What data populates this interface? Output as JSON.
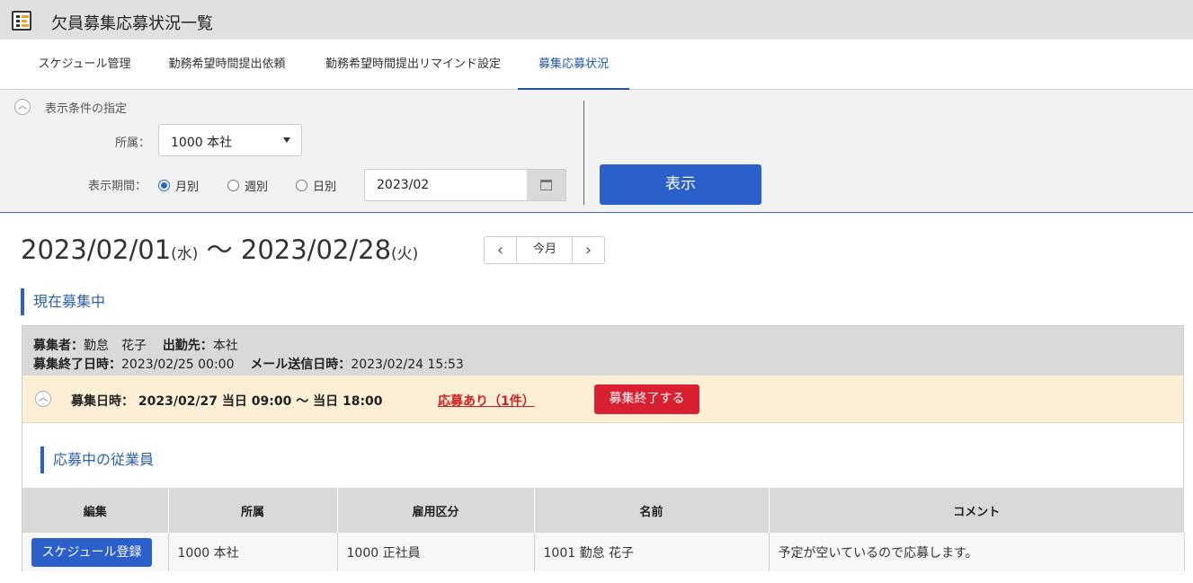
{
  "window": {
    "title": "欠員募集応募状況一覧",
    "icon": "list-app-icon"
  },
  "tabs": [
    {
      "label": "スケジュール管理",
      "active": false
    },
    {
      "label": "勤務希望時間提出依頼",
      "active": false
    },
    {
      "label": "勤務希望時間提出リマインド設定",
      "active": false
    },
    {
      "label": "募集応募状況",
      "active": true
    }
  ],
  "filter": {
    "heading": "表示条件の指定",
    "affiliation_label": "所属：",
    "affiliation_value": "1000 本社",
    "period_label": "表示期間：",
    "period_options": [
      {
        "label": "月別",
        "selected": true
      },
      {
        "label": "週別",
        "selected": false
      },
      {
        "label": "日別",
        "selected": false
      }
    ],
    "date_value": "2023/02",
    "show_button": "表示"
  },
  "range": {
    "start": "2023/02/01",
    "start_dow": "(水)",
    "separator": "〜",
    "end": "2023/02/28",
    "end_dow": "(火)",
    "prev_glyph": "‹",
    "today_label": "今月",
    "next_glyph": "›"
  },
  "current_recruiting": {
    "section_title": "現在募集中",
    "recruiter_label": "募集者：",
    "recruiter_value": "勤怠　花子",
    "workplace_label": "出勤先：",
    "workplace_value": "本社",
    "end_label": "募集終了日時：",
    "end_value": "2023/02/25 00:00",
    "mail_label": "メール送信日時：",
    "mail_value": "2023/02/24 15:53",
    "slot_text": "募集日時： 2023/02/27 当日 09:00 〜 当日 18:00",
    "applications_link": "応募あり（1件）",
    "end_button": "募集終了する",
    "applicants_title": "応募中の従業員",
    "table": {
      "headers": [
        "編集",
        "所属",
        "雇用区分",
        "名前",
        "コメント"
      ],
      "rows": [
        {
          "action": "スケジュール登録",
          "affiliation": "1000 本社",
          "employment": "1000 正社員",
          "name": "1001 勤怠 花子",
          "comment": "予定が空いているので応募します。"
        }
      ]
    }
  },
  "colors": {
    "primary": "#2b5fc9",
    "danger": "#d92030",
    "slot_bg": "#fcefd6",
    "header_bg": "#d9d9d9"
  }
}
